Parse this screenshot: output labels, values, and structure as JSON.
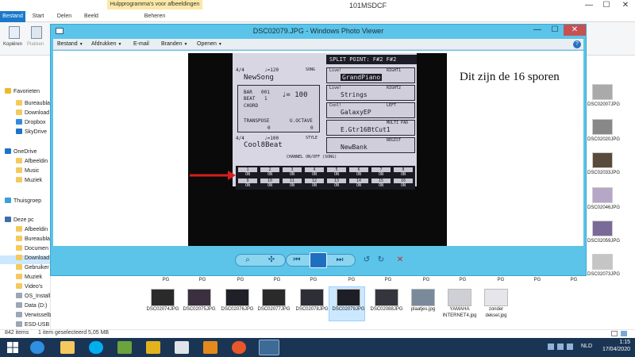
{
  "explorer": {
    "title": "101MSDCF",
    "context_tab_label": "Hulpprogramma's voor afbeeldingen",
    "tabs": [
      "Bestand",
      "Start",
      "Delen",
      "Beeld",
      "Beheren"
    ],
    "ribbon": {
      "copy_label": "Kopiëren",
      "paste_label": "Plakken"
    },
    "window_controls": {
      "minimize": "—",
      "maximize": "☐",
      "close": "✕"
    },
    "nav_items": [
      {
        "label": "Favorieten",
        "icon": "star-icon"
      },
      {
        "label": "Bureaubla",
        "icon": "folder-icon"
      },
      {
        "label": "Download",
        "icon": "folder-icon"
      },
      {
        "label": "Dropbox",
        "icon": "dropbox-icon"
      },
      {
        "label": "SkyDrive",
        "icon": "cloud-icon"
      },
      {
        "label": "OneDrive",
        "icon": "cloud-icon"
      },
      {
        "label": "Afbeeldin",
        "icon": "folder-icon"
      },
      {
        "label": "Music",
        "icon": "folder-icon"
      },
      {
        "label": "Muziek",
        "icon": "folder-icon"
      },
      {
        "label": "Thuisgroep",
        "icon": "network-icon"
      },
      {
        "label": "Deze pc",
        "icon": "pc-icon"
      },
      {
        "label": "Afbeeldin",
        "icon": "folder-icon"
      },
      {
        "label": "Bureaubla",
        "icon": "folder-icon"
      },
      {
        "label": "Documen",
        "icon": "folder-icon"
      },
      {
        "label": "Download",
        "icon": "folder-icon"
      },
      {
        "label": "Gebruiker",
        "icon": "folder-icon"
      },
      {
        "label": "Muziek",
        "icon": "folder-icon"
      },
      {
        "label": "Video's",
        "icon": "folder-icon"
      },
      {
        "label": "OS_Install (C:)",
        "icon": "drive-icon"
      },
      {
        "label": "Data (D:)",
        "icon": "drive-icon"
      },
      {
        "label": "Verwisselbare schijf (F:)",
        "icon": "drive-icon"
      },
      {
        "label": "ESD-USB (G:)",
        "icon": "drive-icon"
      }
    ],
    "right_files": [
      "DSC02007JPG",
      "DSC02020JPG",
      "DSC02033JPG",
      "DSC02046JPG",
      "DSC02059JPG",
      "DSC02073JPG"
    ],
    "partial_row_label": "PG",
    "files_row": [
      {
        "name": "DSC02074JPG"
      },
      {
        "name": "DSC02075JPG"
      },
      {
        "name": "DSC02076JPG"
      },
      {
        "name": "DSC02077JPG"
      },
      {
        "name": "DSC02078JPG"
      },
      {
        "name": "DSC02079JPG",
        "selected": true
      },
      {
        "name": "DSC02088JPG"
      },
      {
        "name": "plaatjes.jpg"
      },
      {
        "name": "YAMAHA INTERNET4.jpg"
      },
      {
        "name": "zonder deksel.jpg"
      }
    ],
    "status": {
      "count": "842 items",
      "selection": "1 item geselecteerd  5,05 MB"
    }
  },
  "photo_viewer": {
    "title": "DSC02079.JPG - Windows Photo Viewer",
    "menus": [
      "Bestand",
      "Afdrukken",
      "E-mail",
      "Branden",
      "Openen"
    ],
    "help_label": "?",
    "close_label": "✕",
    "minimize_label": "—",
    "maximize_label": "☐",
    "annotation": "Dit zijn de 16 sporen"
  },
  "lcd": {
    "header": "SPLIT POINT:",
    "split_left": "F#2",
    "split_right": "F#2",
    "song_meter": "4/4",
    "song_tempo": "♩=120",
    "song_label": "SONG",
    "song_name": "NewSong",
    "bar_label": "BAR",
    "bar_value": "001",
    "beat_label": "BEAT",
    "beat_value": "1",
    "tempo_value": "♩= 100",
    "chord_label": "CHORD",
    "transpose_label": "TRANSPOSE",
    "transpose_value": "0",
    "octave_label": "U.OCTAVE",
    "octave_value": "0",
    "style_meter": "4/4",
    "style_tempo": "♩=100",
    "style_label": "STYLE",
    "style_name": "Cool8Beat",
    "parts": [
      {
        "tag": "RIGHT1",
        "live": "Live!",
        "name": "GrandPiano"
      },
      {
        "tag": "RIGHT2",
        "live": "Live!",
        "name": "Strings"
      },
      {
        "tag": "LEFT",
        "live": "Cool!",
        "name": "GalaxyEP"
      },
      {
        "tag": "MULTI PAD",
        "live": "",
        "name": "E.Gtr16BtCut1"
      },
      {
        "tag": "REGIST",
        "live": "",
        "name": "NewBank"
      }
    ],
    "channel_title": "CHANNEL ON/OFF (SONG)",
    "channels_row1": [
      "1",
      "2",
      "3",
      "4",
      "5",
      "6",
      "7",
      "8"
    ],
    "channels_row2": [
      "9",
      "10",
      "11",
      "12",
      "13",
      "14",
      "15",
      "16"
    ],
    "on_label": "ON"
  },
  "taskbar": {
    "time": "1:15",
    "date": "17/04/2020",
    "language": "NLD",
    "apps": [
      "ie-icon",
      "folder-icon",
      "skype-icon",
      "store-icon",
      "checklist-icon",
      "image-icon",
      "media-icon",
      "firefox-icon",
      "photo-viewer-icon"
    ]
  },
  "colors": {
    "accent": "#1979ca",
    "photo_viewer_frame": "#5bc4e8",
    "taskbar": "#1a3553",
    "arrow": "#d81d1d"
  }
}
